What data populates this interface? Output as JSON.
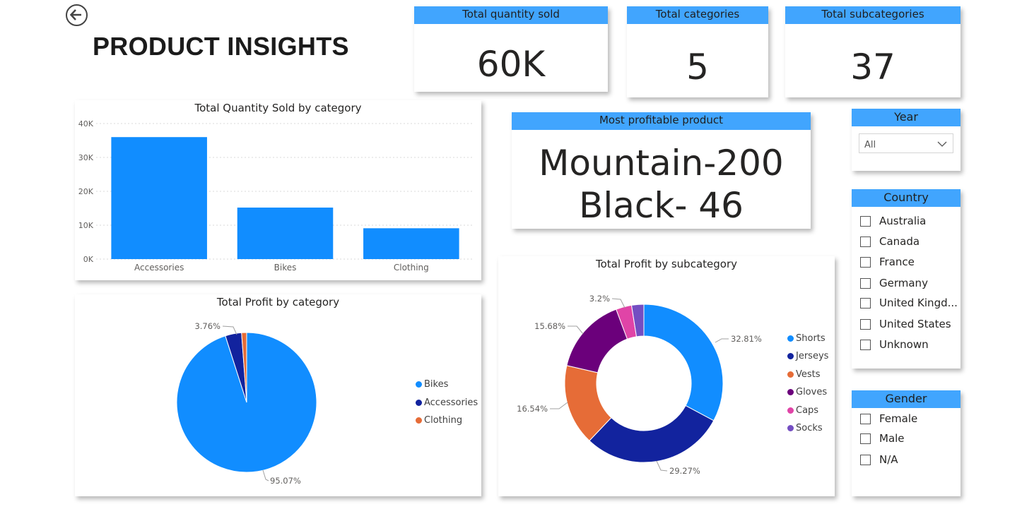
{
  "header": {
    "title": "PRODUCT INSIGHTS",
    "back_icon": "arrow-left-circle-icon"
  },
  "kpis": {
    "total_quantity": {
      "label": "Total quantity sold",
      "value": "60K"
    },
    "total_categories": {
      "label": "Total categories",
      "value": "5"
    },
    "total_subcategories": {
      "label": "Total subcategories",
      "value": "37"
    },
    "most_profitable": {
      "label": "Most profitable product",
      "line1": "Mountain-200",
      "line2": "Black- 46"
    }
  },
  "colors": {
    "header_blue": "#41a5fe",
    "bikes": "#118dff",
    "accessories": "#12239e",
    "clothing": "#e66c37",
    "shorts": "#118dff",
    "jerseys": "#12239e",
    "vests": "#e66c37",
    "gloves": "#6b007b",
    "caps": "#e044a7",
    "socks": "#744ec2"
  },
  "slicers": {
    "year": {
      "label": "Year",
      "selected": "All"
    },
    "country": {
      "label": "Country",
      "options": [
        "Australia",
        "Canada",
        "France",
        "Germany",
        "United Kingd...",
        "United States",
        "Unknown"
      ]
    },
    "gender": {
      "label": "Gender",
      "options": [
        "Female",
        "Male",
        "N/A"
      ]
    }
  },
  "chart_data": [
    {
      "type": "bar",
      "title": "Total Quantity Sold by category",
      "categories": [
        "Accessories",
        "Bikes",
        "Clothing"
      ],
      "values": [
        36000,
        15200,
        9100
      ],
      "yticks": [
        "0K",
        "10K",
        "20K",
        "30K",
        "40K"
      ],
      "ylim": [
        0,
        40000
      ],
      "grid": true
    },
    {
      "type": "pie",
      "title": "Total Profit by category",
      "categories": [
        "Bikes",
        "Accessories",
        "Clothing"
      ],
      "values": [
        95.07,
        3.76,
        1.17
      ],
      "data_labels": [
        "95.07%",
        "3.76%"
      ],
      "legend": "right"
    },
    {
      "type": "pie",
      "title": "Total Profit by subcategory",
      "categories": [
        "Shorts",
        "Jerseys",
        "Vests",
        "Gloves",
        "Caps",
        "Socks"
      ],
      "values": [
        32.81,
        29.27,
        16.54,
        15.68,
        3.2,
        2.5
      ],
      "data_labels": [
        "32.81%",
        "29.27%",
        "16.54%",
        "15.68%",
        "3.2%"
      ],
      "legend": "right"
    }
  ]
}
